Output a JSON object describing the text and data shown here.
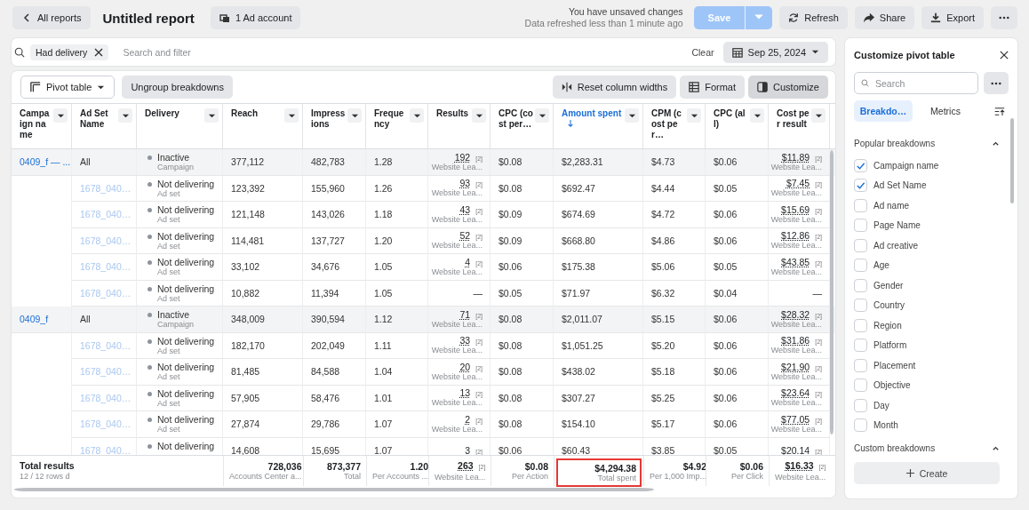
{
  "header": {
    "back": "All reports",
    "title": "Untitled report",
    "account": "1 Ad account",
    "status": "You have unsaved changes",
    "refreshed": "Data refreshed less than 1 minute ago",
    "buttons": [
      {
        "kind": "save",
        "label": "Save",
        "disabled": true
      },
      {
        "kind": "refresh",
        "label": "Refresh"
      },
      {
        "kind": "share",
        "label": "Share"
      },
      {
        "kind": "export",
        "label": "Export"
      },
      {
        "kind": "more"
      }
    ]
  },
  "filter": {
    "chip": "Had delivery",
    "placeholder": "Search and filter",
    "clear": "Clear",
    "date": "Sep 25, 2024"
  },
  "toolbar": {
    "view": "Pivot table",
    "ungroup": "Ungroup breakdowns",
    "buttons": [
      {
        "kind": "reset",
        "label": "Reset column widths",
        "selected": false
      },
      {
        "kind": "format",
        "label": "Format",
        "selected": false
      },
      {
        "kind": "customize",
        "label": "Customize",
        "selected": true
      }
    ]
  },
  "table": {
    "columns": [
      {
        "label": "Campaign name",
        "sorted": false
      },
      {
        "label": "Ad Set Name",
        "sorted": false
      },
      {
        "label": "Delivery",
        "sorted": false
      },
      {
        "label": "Reach",
        "sorted": false
      },
      {
        "label": "Impressions",
        "sorted": false
      },
      {
        "label": "Frequency",
        "sorted": false
      },
      {
        "label": "Results",
        "sorted": false
      },
      {
        "label": "CPC (cost per…",
        "sorted": false
      },
      {
        "label": "Amount spent",
        "sorted": true
      },
      {
        "label": "CPM (cost per…",
        "sorted": false
      },
      {
        "label": "CPC (all)",
        "sorted": false
      },
      {
        "label": "Cost per result",
        "sorted": false
      }
    ],
    "rows": [
      {
        "kind": "campaign",
        "campaign": "0409_f — ...",
        "ad_set": "All",
        "delivery": {
          "status": "Inactive",
          "level_name": "Campaign"
        },
        "metrics": [
          "377,112",
          "482,783",
          "1.28",
          {
            "value": "192",
            "badge": "[2]",
            "sub": "Website Lea..."
          },
          "$0.08",
          "$2,283.31",
          "$4.73",
          "$0.06",
          {
            "value": "$11.89",
            "badge": "[2]",
            "sub": "Website Lea..."
          }
        ]
      },
      {
        "kind": "adset",
        "ad_set": "1678_040…",
        "delivery": {
          "status": "Not delivering",
          "level_name": "Ad set"
        },
        "metrics": [
          "123,392",
          "155,960",
          "1.26",
          {
            "value": "93",
            "badge": "[2]",
            "sub": "Website Lea..."
          },
          "$0.08",
          "$692.47",
          "$4.44",
          "$0.05",
          {
            "value": "$7.45",
            "badge": "[2]",
            "sub": "Website Lea..."
          }
        ]
      },
      {
        "kind": "adset",
        "ad_set": "1678_040…",
        "delivery": {
          "status": "Not delivering",
          "level_name": "Ad set"
        },
        "metrics": [
          "121,148",
          "143,026",
          "1.18",
          {
            "value": "43",
            "badge": "[2]",
            "sub": "Website Lea..."
          },
          "$0.09",
          "$674.69",
          "$4.72",
          "$0.06",
          {
            "value": "$15.69",
            "badge": "[2]",
            "sub": "Website Lea..."
          }
        ]
      },
      {
        "kind": "adset",
        "ad_set": "1678_040…",
        "delivery": {
          "status": "Not delivering",
          "level_name": "Ad set"
        },
        "metrics": [
          "114,481",
          "137,727",
          "1.20",
          {
            "value": "52",
            "badge": "[2]",
            "sub": "Website Lea..."
          },
          "$0.09",
          "$668.80",
          "$4.86",
          "$0.06",
          {
            "value": "$12.86",
            "badge": "[2]",
            "sub": "Website Lea..."
          }
        ]
      },
      {
        "kind": "adset",
        "ad_set": "1678_040…",
        "delivery": {
          "status": "Not delivering",
          "level_name": "Ad set"
        },
        "metrics": [
          "33,102",
          "34,676",
          "1.05",
          {
            "value": "4",
            "badge": "[2]",
            "sub": "Website Lea..."
          },
          "$0.06",
          "$175.38",
          "$5.06",
          "$0.05",
          {
            "value": "$43.85",
            "badge": "[2]",
            "sub": "Website Lea..."
          }
        ]
      },
      {
        "kind": "adset",
        "ad_set": "1678_040…",
        "delivery": {
          "status": "Not delivering",
          "level_name": "Ad set"
        },
        "metrics": [
          "10,882",
          "11,394",
          "1.05",
          {
            "value": "—"
          },
          "$0.05",
          "$71.97",
          "$6.32",
          "$0.04",
          {
            "value": "—"
          }
        ]
      },
      {
        "kind": "campaign",
        "campaign": "0409_f",
        "ad_set": "All",
        "delivery": {
          "status": "Inactive",
          "level_name": "Campaign"
        },
        "metrics": [
          "348,009",
          "390,594",
          "1.12",
          {
            "value": "71",
            "badge": "[2]",
            "sub": "Website Lea..."
          },
          "$0.08",
          "$2,011.07",
          "$5.15",
          "$0.06",
          {
            "value": "$28.32",
            "badge": "[2]",
            "sub": "Website Lea..."
          }
        ]
      },
      {
        "kind": "adset",
        "ad_set": "1678_040…",
        "delivery": {
          "status": "Not delivering",
          "level_name": "Ad set"
        },
        "metrics": [
          "182,170",
          "202,049",
          "1.11",
          {
            "value": "33",
            "badge": "[2]",
            "sub": "Website Lea..."
          },
          "$0.08",
          "$1,051.25",
          "$5.20",
          "$0.06",
          {
            "value": "$31.86",
            "badge": "[2]",
            "sub": "Website Lea..."
          }
        ]
      },
      {
        "kind": "adset",
        "ad_set": "1678_040…",
        "delivery": {
          "status": "Not delivering",
          "level_name": "Ad set"
        },
        "metrics": [
          "81,485",
          "84,588",
          "1.04",
          {
            "value": "20",
            "badge": "[2]",
            "sub": "Website Lea..."
          },
          "$0.08",
          "$438.02",
          "$5.18",
          "$0.06",
          {
            "value": "$21.90",
            "badge": "[2]",
            "sub": "Website Lea..."
          }
        ]
      },
      {
        "kind": "adset",
        "ad_set": "1678_040…",
        "delivery": {
          "status": "Not delivering",
          "level_name": "Ad set"
        },
        "metrics": [
          "57,905",
          "58,476",
          "1.01",
          {
            "value": "13",
            "badge": "[2]",
            "sub": "Website Lea..."
          },
          "$0.08",
          "$307.27",
          "$5.25",
          "$0.06",
          {
            "value": "$23.64",
            "badge": "[2]",
            "sub": "Website Lea..."
          }
        ]
      },
      {
        "kind": "adset",
        "ad_set": "1678_040…",
        "delivery": {
          "status": "Not delivering",
          "level_name": "Ad set"
        },
        "metrics": [
          "27,874",
          "29,786",
          "1.07",
          {
            "value": "2",
            "badge": "[2]",
            "sub": "Website Lea..."
          },
          "$0.08",
          "$154.10",
          "$5.17",
          "$0.06",
          {
            "value": "$77.05",
            "badge": "[2]",
            "sub": "Website Lea..."
          }
        ]
      },
      {
        "kind": "adset",
        "ad_set": "1678_040…",
        "delivery": {
          "status": "Not delivering"
        },
        "metrics": [
          "14,608",
          "15,695",
          "1.07",
          {
            "value": "3",
            "badge": "[2]"
          },
          "$0.06",
          "$60.43",
          "$3.85",
          "$0.05",
          {
            "value": "$20.14",
            "badge": "[2]"
          }
        ]
      }
    ],
    "totals": {
      "label": "Total results",
      "rows": "12 / 12 rows d",
      "cells": [
        {
          "value": "728,036",
          "sub": "Accounts Center a...",
          "highlighted": false
        },
        {
          "value": "873,377",
          "sub": "Total",
          "highlighted": false
        },
        {
          "value": "1.20",
          "sub": "Per Accounts ...",
          "highlighted": false
        },
        {
          "value": "263",
          "badge": "[2]",
          "sub": "Website Lea...",
          "highlighted": false
        },
        {
          "value": "$0.08",
          "sub": "Per Action",
          "highlighted": false
        },
        {
          "value": "$4,294.38",
          "sub": "Total spent",
          "highlighted": true
        },
        {
          "value": "$4.92",
          "sub": "Per 1,000 Imp...",
          "highlighted": false
        },
        {
          "value": "$0.06",
          "sub": "Per Click",
          "highlighted": false
        },
        {
          "value": "$16.33",
          "badge": "[2]",
          "sub": "Website Lea...",
          "highlighted": false
        }
      ]
    }
  },
  "panel": {
    "title": "Customize pivot table",
    "search_placeholder": "Search",
    "tabs": [
      {
        "label": "Breakdo…",
        "selected": true
      },
      {
        "label": "Metrics",
        "selected": false
      }
    ],
    "sections": [
      {
        "title": "Popular breakdowns",
        "expanded": true,
        "items": [
          {
            "label": "Campaign name",
            "checked": true
          },
          {
            "label": "Ad Set Name",
            "checked": true
          },
          {
            "label": "Ad name",
            "checked": false
          },
          {
            "label": "Page Name",
            "checked": false
          },
          {
            "label": "Ad creative",
            "checked": false
          },
          {
            "label": "Age",
            "checked": false
          },
          {
            "label": "Gender",
            "checked": false
          },
          {
            "label": "Country",
            "checked": false
          },
          {
            "label": "Region",
            "checked": false
          },
          {
            "label": "Platform",
            "checked": false
          },
          {
            "label": "Placement",
            "checked": false
          },
          {
            "label": "Objective",
            "checked": false
          },
          {
            "label": "Day",
            "checked": false
          },
          {
            "label": "Month",
            "checked": false
          }
        ]
      },
      {
        "title": "Custom breakdowns",
        "expanded": true,
        "action": "Create"
      }
    ]
  }
}
